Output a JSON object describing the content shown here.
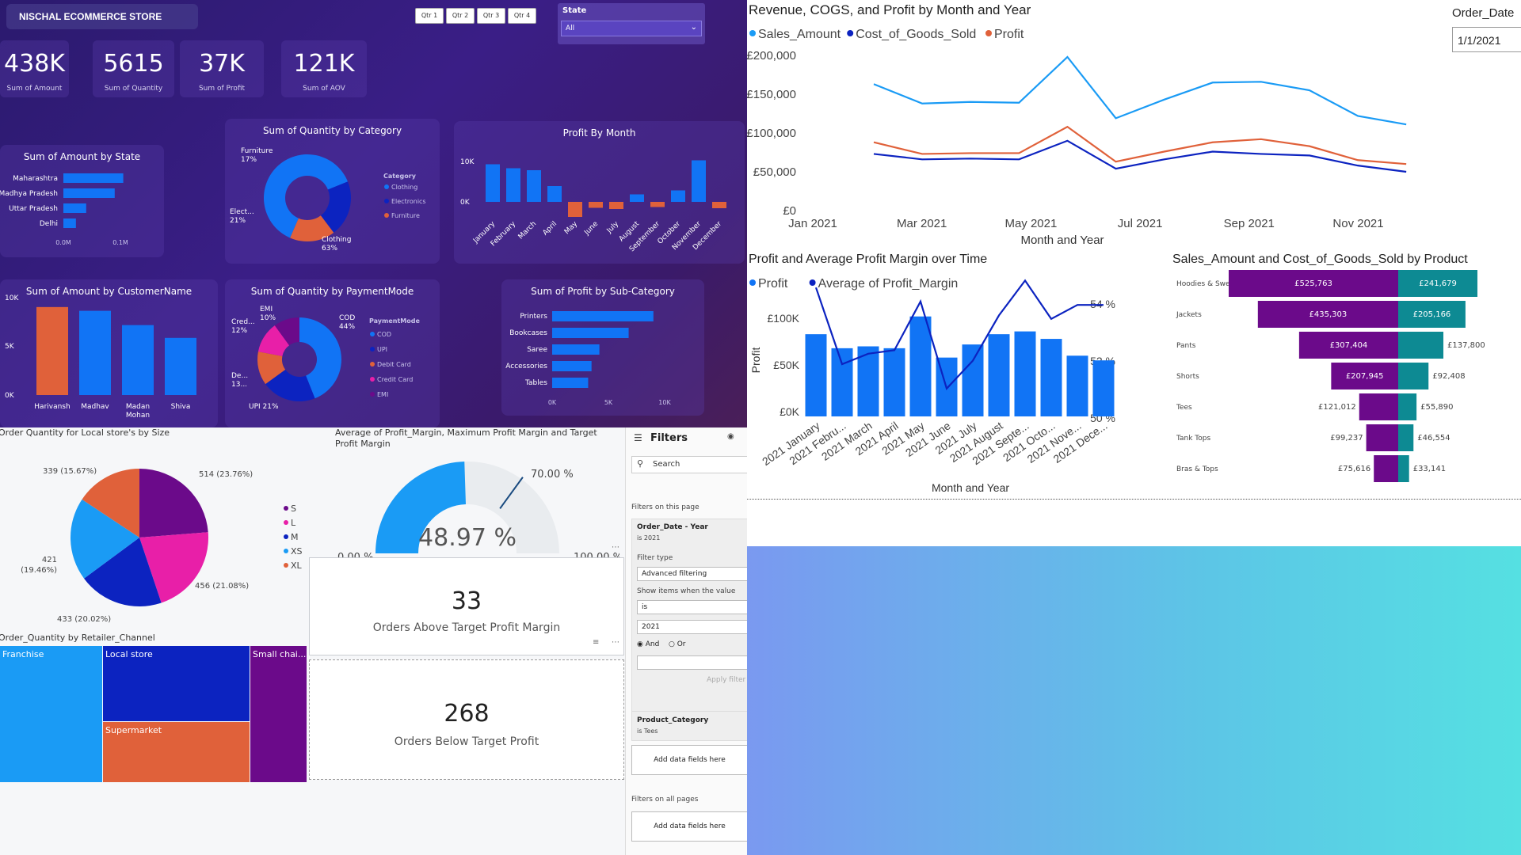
{
  "header": {
    "title": "NISCHAL ECOMMERCE STORE"
  },
  "quarter_buttons": [
    "Qtr 1",
    "Qtr 2",
    "Qtr 3",
    "Qtr 4"
  ],
  "state_slicer": {
    "label": "State",
    "value": "All"
  },
  "kpis": [
    {
      "value": "438K",
      "label": "Sum of Amount"
    },
    {
      "value": "5615",
      "label": "Sum of Quantity"
    },
    {
      "value": "37K",
      "label": "Sum of Profit"
    },
    {
      "value": "121K",
      "label": "Sum of AOV"
    }
  ],
  "colors": {
    "blue": "#1174f5",
    "orange": "#e0613a",
    "navy": "#0c23c0",
    "pink": "#e81fa8",
    "purple": "#6b0a8a",
    "light_blue": "#1a9bf5",
    "teal": "#0d8a93"
  },
  "chart_data": [
    {
      "type": "bar",
      "title": "Sum of Amount by State",
      "categories": [
        "Maharashtra",
        "Madhya Pradesh",
        "Uttar Pradesh",
        "Delhi"
      ],
      "values": [
        0.105,
        0.09,
        0.04,
        0.022
      ],
      "xticks": [
        "0.0M",
        "0.1M"
      ]
    },
    {
      "type": "pie",
      "title": "Sum of Quantity by Category",
      "legend_title": "Category",
      "categories": [
        "Clothing",
        "Electronics",
        "Furniture"
      ],
      "values": [
        63,
        21,
        17
      ],
      "slice_labels": [
        "Clothing\n63%",
        "Elect...\n21%",
        "Furniture\n17%"
      ]
    },
    {
      "type": "bar",
      "title": "Profit By Month",
      "categories": [
        "January",
        "February",
        "March",
        "April",
        "May",
        "June",
        "July",
        "August",
        "September",
        "October",
        "November",
        "December"
      ],
      "values": [
        9500,
        8500,
        8000,
        4000,
        -3800,
        -1500,
        -1800,
        1900,
        -1300,
        2900,
        10500,
        -1600
      ],
      "yticks": [
        "10K",
        "0K"
      ]
    },
    {
      "type": "bar",
      "title": "Sum of Amount by CustomerName",
      "categories": [
        "Harivansh",
        "Madhav",
        "Madan Mohan",
        "Shiva"
      ],
      "values": [
        11700,
        11200,
        9300,
        7600
      ],
      "yticks": [
        "10K",
        "5K",
        "0K"
      ]
    },
    {
      "type": "pie",
      "title": "Sum of Quantity by PaymentMode",
      "legend_title": "PaymentMode",
      "categories": [
        "COD",
        "UPI",
        "Debit Card",
        "Credit Card",
        "EMI"
      ],
      "values": [
        44,
        21,
        13,
        12,
        10
      ],
      "slice_labels": [
        "COD\n44%",
        "UPI 21%",
        "De...\n13...",
        "Cred...\n12%",
        "EMI\n10%"
      ]
    },
    {
      "type": "bar",
      "title": "Sum of Profit by Sub-Category",
      "categories": [
        "Printers",
        "Bookcases",
        "Saree",
        "Accessories",
        "Tables"
      ],
      "values": [
        9000,
        6800,
        4200,
        3500,
        3200
      ],
      "xticks": [
        "0K",
        "5K",
        "10K"
      ]
    },
    {
      "type": "line",
      "title": "Revenue, COGS, and Profit by Month and Year",
      "xlabel": "Month and Year",
      "x": [
        "Jan 2021",
        "Feb 2021",
        "Mar 2021",
        "Apr 2021",
        "May 2021",
        "Jun 2021",
        "Jul 2021",
        "Aug 2021",
        "Sep 2021",
        "Oct 2021",
        "Nov 2021",
        "Dec 2021"
      ],
      "xticks": [
        "Jan 2021",
        "Mar 2021",
        "May 2021",
        "Jul 2021",
        "Sep 2021",
        "Nov 2021"
      ],
      "yticks": [
        "£200,000",
        "£150,000",
        "£100,000",
        "£50,000",
        "£0"
      ],
      "ylim": [
        0,
        200000
      ],
      "series": [
        {
          "name": "Sales_Amount",
          "values": [
            162000,
            137000,
            139000,
            138000,
            197000,
            118000,
            142000,
            164000,
            165000,
            154000,
            121000,
            110000
          ]
        },
        {
          "name": "Cost_of_Goods_Sold",
          "values": [
            72000,
            65000,
            66000,
            65000,
            89000,
            53000,
            65000,
            75000,
            72000,
            70000,
            57000,
            49000
          ]
        },
        {
          "name": "Profit",
          "values": [
            87000,
            72000,
            73000,
            73000,
            107000,
            62000,
            75000,
            87000,
            91000,
            82000,
            64000,
            59000
          ]
        }
      ]
    },
    {
      "type": "bar",
      "title": "Profit and Average Profit Margin over Time",
      "xlabel": "Month and Year",
      "ylabel": "Profit",
      "ylabel2": "Average of Profit_...",
      "categories": [
        "2021 January",
        "2021 Febru...",
        "2021 March",
        "2021 April",
        "2021 May",
        "2021 June",
        "2021 July",
        "2021 August",
        "2021 Septe...",
        "2021 Octo...",
        "2021 Nove...",
        "2021 Dece..."
      ],
      "yticks": [
        "£100K",
        "£50K",
        "£0K"
      ],
      "yticks2": [
        "54 %",
        "52 %",
        "50 %"
      ],
      "series": [
        {
          "name": "Profit",
          "values": [
            88000,
            73000,
            75000,
            73000,
            107000,
            63000,
            77000,
            88000,
            91000,
            83000,
            65000,
            60000
          ]
        },
        {
          "name": "Average of Profit_Margin",
          "values": [
            53.7,
            51.5,
            51.8,
            51.9,
            53.3,
            50.8,
            51.6,
            52.9,
            53.9,
            52.8,
            53.2,
            53.2
          ]
        }
      ]
    },
    {
      "type": "bar",
      "title": "Sales_Amount and Cost_of_Goods_Sold by Product",
      "categories": [
        "Hoodies & Sweatshirts",
        "Jackets",
        "Pants",
        "Shorts",
        "Tees",
        "Tank Tops",
        "Bras & Tops"
      ],
      "series": [
        {
          "name": "Sales_Amount",
          "values": [
            525763,
            435303,
            307404,
            207945,
            121012,
            99237,
            75616
          ],
          "labels": [
            "£525,763",
            "£435,303",
            "£307,404",
            "£207,945",
            "£121,012",
            "£99,237",
            "£75,616"
          ]
        },
        {
          "name": "Cost_of_Goods_Sold",
          "values": [
            241679,
            205166,
            137800,
            92408,
            55890,
            46554,
            33141
          ],
          "labels": [
            "£241,679",
            "£205,166",
            "£137,800",
            "£92,408",
            "£55,890",
            "£46,554",
            "£33,141"
          ]
        }
      ]
    },
    {
      "type": "pie",
      "title": "Order Quantity for Local store's by Size",
      "categories": [
        "S",
        "L",
        "M",
        "XS",
        "XL"
      ],
      "values": [
        514,
        456,
        433,
        421,
        339
      ],
      "slice_labels": [
        "514 (23.76%)",
        "456 (21.08%)",
        "433 (20.02%)",
        "421 (19.46%)",
        "339 (15.67%)"
      ]
    },
    {
      "type": "heatmap",
      "title": "Order_Quantity by Retailer_Channel",
      "categories": [
        "Franchise",
        "Local store",
        "Supermarket",
        "Small chai..."
      ]
    }
  ],
  "gauge": {
    "title": "Average of Profit_Margin, Maximum Profit Margin and Target Profit Margin",
    "value": 48.97,
    "value_label": "48.97 %",
    "min_label": "0.00 %",
    "max_label": "100.00 %",
    "target_label": "70.00 %",
    "target": 70
  },
  "cards": [
    {
      "value": "33",
      "label": "Orders Above Target Profit Margin"
    },
    {
      "value": "268",
      "label": "Orders Below Target Profit"
    }
  ],
  "order_date_slicer": {
    "title": "Order_Date",
    "value": "1/1/2021"
  },
  "filters": {
    "title": "Filters",
    "search_placeholder": "Search",
    "on_this_page": "Filters on this page",
    "card1_title": "Order_Date - Year",
    "card1_sub": "is 2021",
    "filter_type_label": "Filter type",
    "filter_type_value": "Advanced filtering",
    "show_items_label": "Show items when the value",
    "operator": "is",
    "value": "2021",
    "and_label": "And",
    "or_label": "Or",
    "apply": "Apply filter",
    "card2_title": "Product_Category",
    "card2_sub": "is Tees",
    "add_fields": "Add data fields here",
    "on_all_pages": "Filters on all pages",
    "add_fields2": "Add data fields here"
  }
}
